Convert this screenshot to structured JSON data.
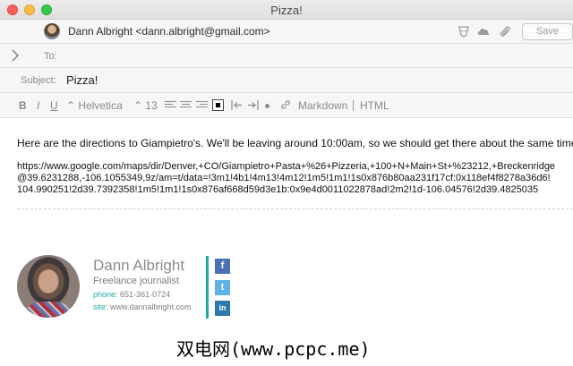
{
  "window": {
    "title": "Pizza!"
  },
  "header": {
    "from": "Dann Albright <dann.albright@gmail.com>",
    "save_label": "Save",
    "to_label": "To:",
    "subject_label": "Subject:",
    "subject": "Pizza!"
  },
  "toolbar": {
    "bold": "B",
    "italic": "I",
    "underline": "U",
    "font": "⌃ Helvetica",
    "size": "⌃ 13",
    "markdown": "Markdown",
    "html": "HTML"
  },
  "body": {
    "message": "Here are the directions to Giampietro's. We'll be leaving around 10:00am, so we should get there about the same time!",
    "link_lines": [
      "https://www.google.com/maps/dir/Denver,+CO/Giampietro+Pasta+%26+Pizzeria,+100+N+Main+St+%23212,+Breckenridge",
      "@39.6231288,-106.1055349,9z/am=t/data=!3m1!4b1!4m13!4m12!1m5!1m1!1s0x876b80aa231f17cf:0x118ef4f8278a36d6!",
      "104.990251!2d39.7392358!1m5!1m1!1s0x876af668d59d3e1b:0x9e4d0011022878ad!2m2!1d-106.04576!2d39.4825035"
    ]
  },
  "signature": {
    "name": "Dann Albright",
    "role": "Freelance journalist",
    "phone_label": "phone:",
    "phone": "651-361-0724",
    "site_label": "site:",
    "site": "www.dannalbright.com",
    "social": [
      "f",
      "t",
      "in"
    ]
  },
  "watermark": "双电网(www.pcpc.me)",
  "colors": {
    "accent": "#1fa8a8",
    "facebook": "#4a6fb3",
    "twitter": "#5fb2e4",
    "linkedin": "#2e78ae"
  }
}
